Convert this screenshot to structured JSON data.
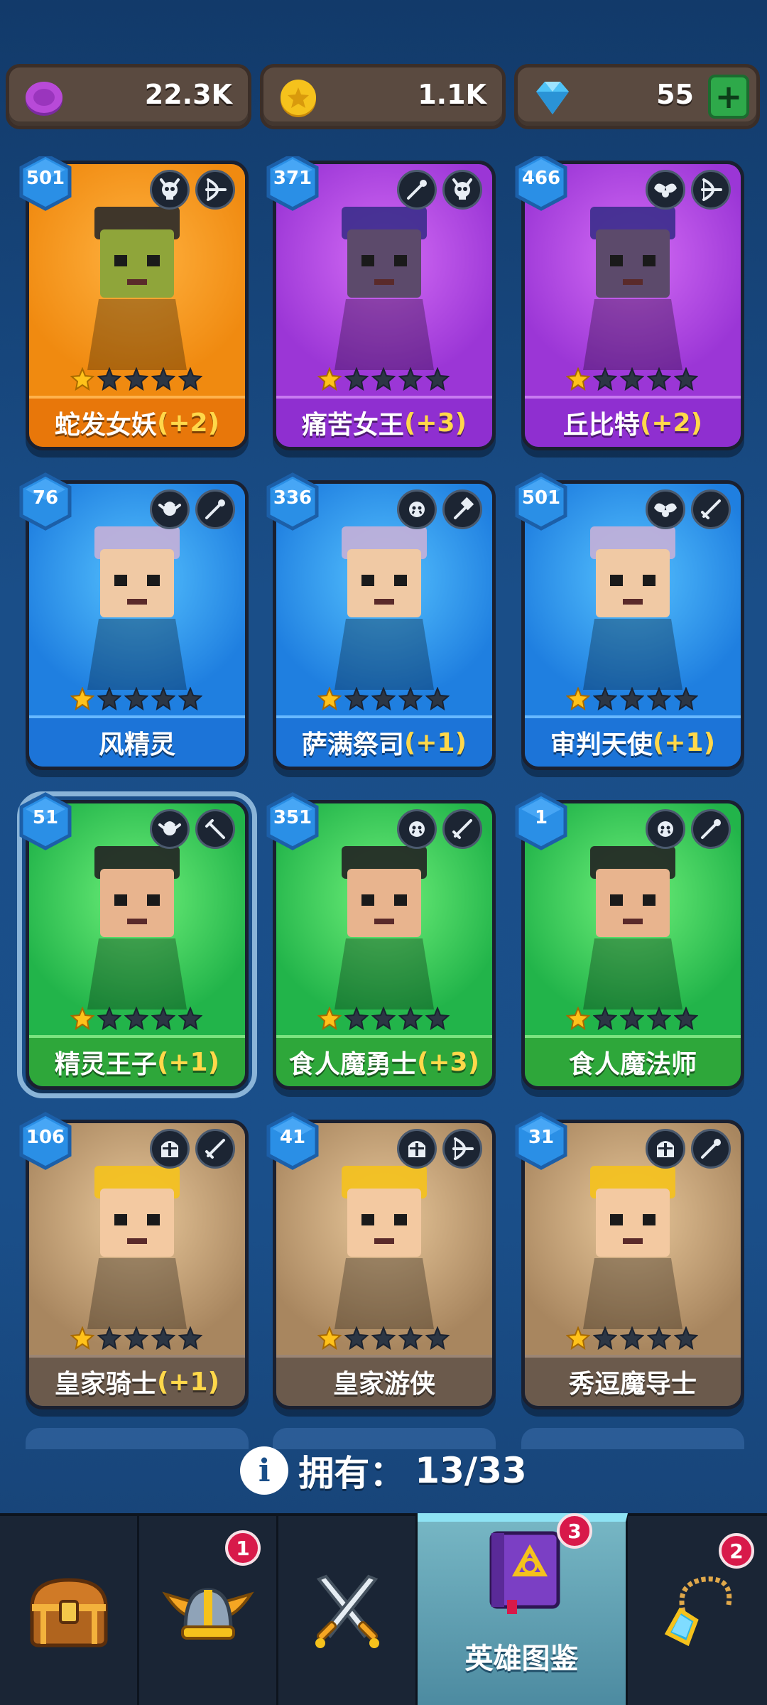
{
  "currencies": [
    {
      "name": "purple-gem-coin",
      "amount": "22.3K",
      "color": "#b84ad8"
    },
    {
      "name": "gold-coin",
      "amount": "1.1K",
      "color": "#f5c21c"
    },
    {
      "name": "diamond",
      "amount": "55",
      "color": "#4fc3f7",
      "has_plus": true
    }
  ],
  "plus_label": "+",
  "heroes": [
    {
      "level": "501",
      "name": "蛇发女妖",
      "bonus": "(+2)",
      "faction": "orange",
      "stars": 1,
      "roles": [
        "demon-skull-icon",
        "bow-icon"
      ]
    },
    {
      "level": "371",
      "name": "痛苦女王",
      "bonus": "(+3)",
      "faction": "purple",
      "stars": 1,
      "roles": [
        "staff-icon",
        "demon-skull-icon"
      ]
    },
    {
      "level": "466",
      "name": "丘比特",
      "bonus": "(+2)",
      "faction": "purple",
      "stars": 1,
      "roles": [
        "angel-wings-icon",
        "bow-icon"
      ]
    },
    {
      "level": "76",
      "name": "风精灵",
      "bonus": "",
      "faction": "blue",
      "stars": 1,
      "roles": [
        "elf-head-icon",
        "staff-icon"
      ]
    },
    {
      "level": "336",
      "name": "萨满祭司",
      "bonus": "(+1)",
      "faction": "blue",
      "stars": 1,
      "roles": [
        "orc-head-icon",
        "hammer-icon"
      ]
    },
    {
      "level": "501",
      "name": "审判天使",
      "bonus": "(+1)",
      "faction": "blue",
      "stars": 1,
      "roles": [
        "angel-wings-icon",
        "sword-icon"
      ]
    },
    {
      "level": "51",
      "name": "精灵王子",
      "bonus": "(+1)",
      "faction": "green",
      "stars": 1,
      "roles": [
        "elf-head-icon",
        "dagger-icon"
      ],
      "selected": true
    },
    {
      "level": "351",
      "name": "食人魔勇士",
      "bonus": "(+3)",
      "faction": "green",
      "stars": 1,
      "roles": [
        "orc-head-icon",
        "sword-icon"
      ]
    },
    {
      "level": "1",
      "name": "食人魔法师",
      "bonus": "",
      "faction": "green",
      "stars": 1,
      "roles": [
        "orc-head-icon",
        "staff-icon"
      ]
    },
    {
      "level": "106",
      "name": "皇家骑士",
      "bonus": "(+1)",
      "faction": "brown",
      "stars": 1,
      "roles": [
        "knight-helmet-icon",
        "sword-icon"
      ]
    },
    {
      "level": "41",
      "name": "皇家游侠",
      "bonus": "",
      "faction": "brown",
      "stars": 1,
      "roles": [
        "knight-helmet-icon",
        "bow-icon"
      ]
    },
    {
      "level": "31",
      "name": "秀逗魔导士",
      "bonus": "",
      "faction": "brown",
      "stars": 1,
      "roles": [
        "knight-helmet-icon",
        "staff-icon"
      ]
    }
  ],
  "owned": {
    "label": "拥有：",
    "value": "13/33"
  },
  "nav": {
    "tabs": [
      {
        "name": "shop-tab",
        "icon": "treasure-chest-icon",
        "label": "",
        "badge": ""
      },
      {
        "name": "heroes-tab",
        "icon": "winged-helmet-icon",
        "label": "",
        "badge": "1"
      },
      {
        "name": "battle-tab",
        "icon": "crossed-swords-icon",
        "label": "",
        "badge": ""
      },
      {
        "name": "hero-codex-tab",
        "icon": "spellbook-icon",
        "label": "英雄图鉴",
        "badge": "3",
        "active": true
      },
      {
        "name": "equipment-tab",
        "icon": "amulet-icon",
        "label": "",
        "badge": "2"
      }
    ]
  },
  "colors": {
    "accent": "#8ee3f4",
    "badge": "#d8194a",
    "bonus": "#ffd84a",
    "star": "#ffc21a"
  }
}
